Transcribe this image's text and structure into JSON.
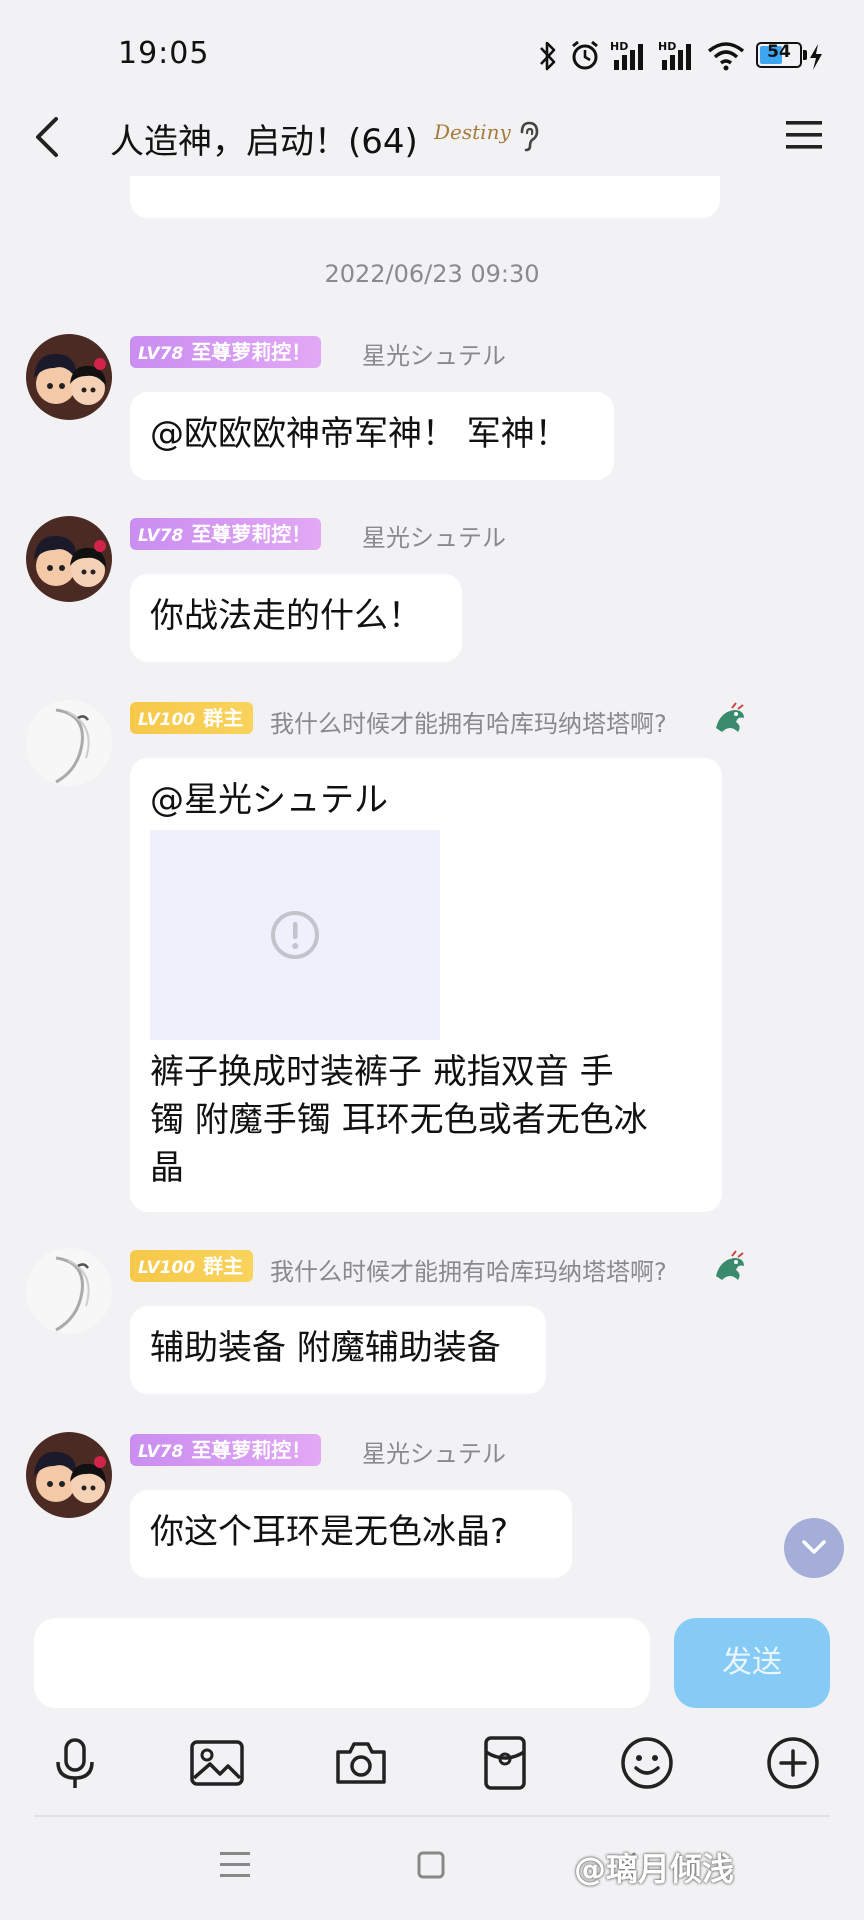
{
  "status_bar": {
    "time": "19:05",
    "battery": "54",
    "hd1": "HD",
    "hd2": "HD"
  },
  "header": {
    "title": "人造神，启动！(64)",
    "badge_text": "Destiny"
  },
  "timestamp": "2022/06/23 09:30",
  "messages": [
    {
      "badge_level": "LV78",
      "badge_title": "至尊萝莉控！",
      "nickname": "星光シュテル",
      "text": "@欧欧欧神帝军神！  军神！"
    },
    {
      "badge_level": "LV78",
      "badge_title": "至尊萝莉控！",
      "nickname": "星光シュテル",
      "text": "你战法走的什么！"
    },
    {
      "badge_level": "LV100",
      "badge_title": "群主",
      "nickname": "我什么时候才能拥有哈库玛纳塔塔啊?",
      "mention": "@星光シュテル",
      "line1": "裤子换成时装裤子  戒指双音   手",
      "line2": "镯 附魔手镯  耳环无色或者无色冰",
      "line3": "晶"
    },
    {
      "badge_level": "LV100",
      "badge_title": "群主",
      "nickname": "我什么时候才能拥有哈库玛纳塔塔啊?",
      "text": "辅助装备 附魔辅助装备"
    },
    {
      "badge_level": "LV78",
      "badge_title": "至尊萝莉控！",
      "nickname": "星光シュテル",
      "text": "你这个耳环是无色冰晶?"
    }
  ],
  "input": {
    "placeholder": "",
    "send_label": "发送"
  },
  "toolbar": [
    "mic-icon",
    "image-icon",
    "camera-icon",
    "red-packet-icon",
    "emoji-icon",
    "plus-icon"
  ],
  "watermark": "@璃月倾浅",
  "colors": {
    "send": "#86cbf6",
    "badge_purple": "#c98ef0",
    "badge_gold": "#f6c84a",
    "background": "#f2f2f4"
  }
}
